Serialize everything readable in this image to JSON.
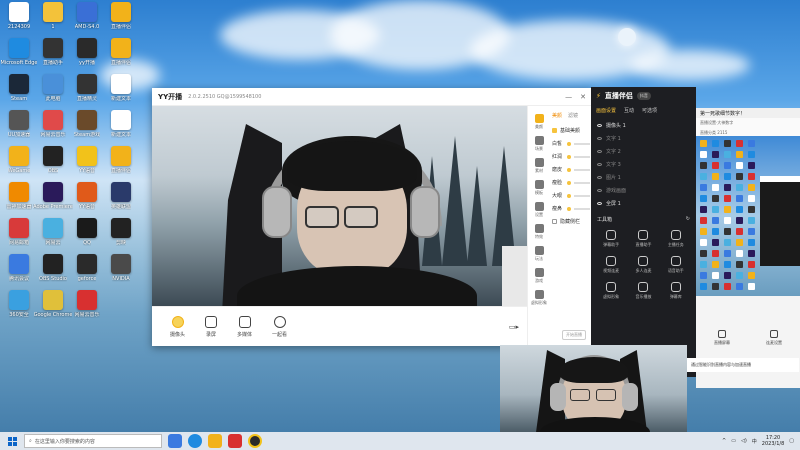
{
  "desktop": {
    "icons": [
      {
        "label": "2124309",
        "color": "#ffffff"
      },
      {
        "label": "1",
        "color": "#f3c23a"
      },
      {
        "label": "AMD-S4.0",
        "color": "#3a6fd6"
      },
      {
        "label": "直播伴侣",
        "color": "#f2b21a"
      },
      {
        "label": "Microsoft Edge",
        "color": "#1f8be0"
      },
      {
        "label": "直播助手",
        "color": "#333333"
      },
      {
        "label": "yy开播",
        "color": "#2a2a2a"
      },
      {
        "label": "直播伴侣",
        "color": "#f2b21a"
      },
      {
        "label": "Steam",
        "color": "#1b2838"
      },
      {
        "label": "此电脑",
        "color": "#4a90d9"
      },
      {
        "label": "直播精灵",
        "color": "#333333"
      },
      {
        "label": "新建文本",
        "color": "#ffffff"
      },
      {
        "label": "UU加速器",
        "color": "#555555"
      },
      {
        "label": "网易云音乐",
        "color": "#e04a4a"
      },
      {
        "label": "Steam游戏",
        "color": "#6a4a2a"
      },
      {
        "label": "新建文本",
        "color": "#ffffff"
      },
      {
        "label": "WeGame",
        "color": "#f2b21a"
      },
      {
        "label": "OBS",
        "color": "#222222"
      },
      {
        "label": "YY语音",
        "color": "#f2c21a"
      },
      {
        "label": "直播伴侣",
        "color": "#f2b21a"
      },
      {
        "label": "雷神加速器",
        "color": "#f08a00"
      },
      {
        "label": "Adobe Premiere",
        "color": "#2a1a5a"
      },
      {
        "label": "YY语音",
        "color": "#e05a1a"
      },
      {
        "label": "英雄联盟",
        "color": "#2a3a6a"
      },
      {
        "label": "网易邮箱",
        "color": "#d83a3a"
      },
      {
        "label": "网易云",
        "color": "#4ab0e0"
      },
      {
        "label": "QQ",
        "color": "#1a1a1a"
      },
      {
        "label": "剪映",
        "color": "#222222"
      },
      {
        "label": "腾讯会议",
        "color": "#3a7ae0"
      },
      {
        "label": "OBS Studio",
        "color": "#222222"
      },
      {
        "label": "geforce",
        "color": "#2a2a2a"
      },
      {
        "label": "NVIDIA",
        "color": "#4a4a4a"
      },
      {
        "label": "360安全",
        "color": "#3aa0e0"
      },
      {
        "label": "Google Chrome",
        "color": "#e0c03a"
      },
      {
        "label": "网易云音乐",
        "color": "#d83030"
      }
    ]
  },
  "yy_window": {
    "title": "YY开播",
    "version": "2.0.2.2510 GQ@1599548100",
    "min": "—",
    "close": "✕",
    "toolbar": [
      {
        "label": "摄像头"
      },
      {
        "label": "录屏"
      },
      {
        "label": "多媒体"
      },
      {
        "label": "一起看"
      }
    ],
    "side_icons": [
      {
        "label": "美颜"
      },
      {
        "label": "场景"
      },
      {
        "label": "素材"
      },
      {
        "label": "模板"
      },
      {
        "label": "设置"
      },
      {
        "label": "特效"
      },
      {
        "label": "玩法"
      },
      {
        "label": "游戏"
      },
      {
        "label": "虚拟形象"
      }
    ],
    "panel_tab": "美颜",
    "panel_tab2": "滤镜",
    "panel_toggle": "基础美颜",
    "sliders": [
      "白皙",
      "红润",
      "磨皮",
      "瘦脸",
      "大眼",
      "瘦鼻"
    ],
    "panel_footer": "隐藏侧栏",
    "bottom_right": "开始直播"
  },
  "dark_panel": {
    "title": "直播伴侣",
    "badge": "抖音",
    "tabs": [
      "画面设置",
      "互动",
      "可选项"
    ],
    "sources": [
      {
        "name": "摄像头 1",
        "on": true
      },
      {
        "name": "文字 1",
        "on": false
      },
      {
        "name": "文字 2",
        "on": false
      },
      {
        "name": "文字 3",
        "on": false
      },
      {
        "name": "图片 1",
        "on": false
      },
      {
        "name": "游戏画面",
        "on": false
      },
      {
        "name": "全屏 1",
        "on": true
      }
    ],
    "tools_title": "工具箱",
    "tools": [
      {
        "label": "弹幕助手"
      },
      {
        "label": "直播助手"
      },
      {
        "label": "主播任务"
      },
      {
        "label": "视频连麦"
      },
      {
        "label": "多人连麦"
      },
      {
        "label": "语音助手"
      },
      {
        "label": "虚拟形象"
      },
      {
        "label": "音乐播放"
      },
      {
        "label": "弹幕库"
      }
    ]
  },
  "preview_panel": {
    "title": "第一死歌细节数字！",
    "subtitle": "直播设置·大神数字",
    "line3": "直播分类 2115",
    "buttons": [
      {
        "label": "直播屏幕"
      },
      {
        "label": "连麦设置"
      }
    ]
  },
  "toast": {
    "text": "通过智能识别直播内容与加速直播"
  },
  "taskbar": {
    "search_placeholder": "在这里输入你要搜索的内容",
    "time": "17:20",
    "date": "2023/1/8"
  }
}
